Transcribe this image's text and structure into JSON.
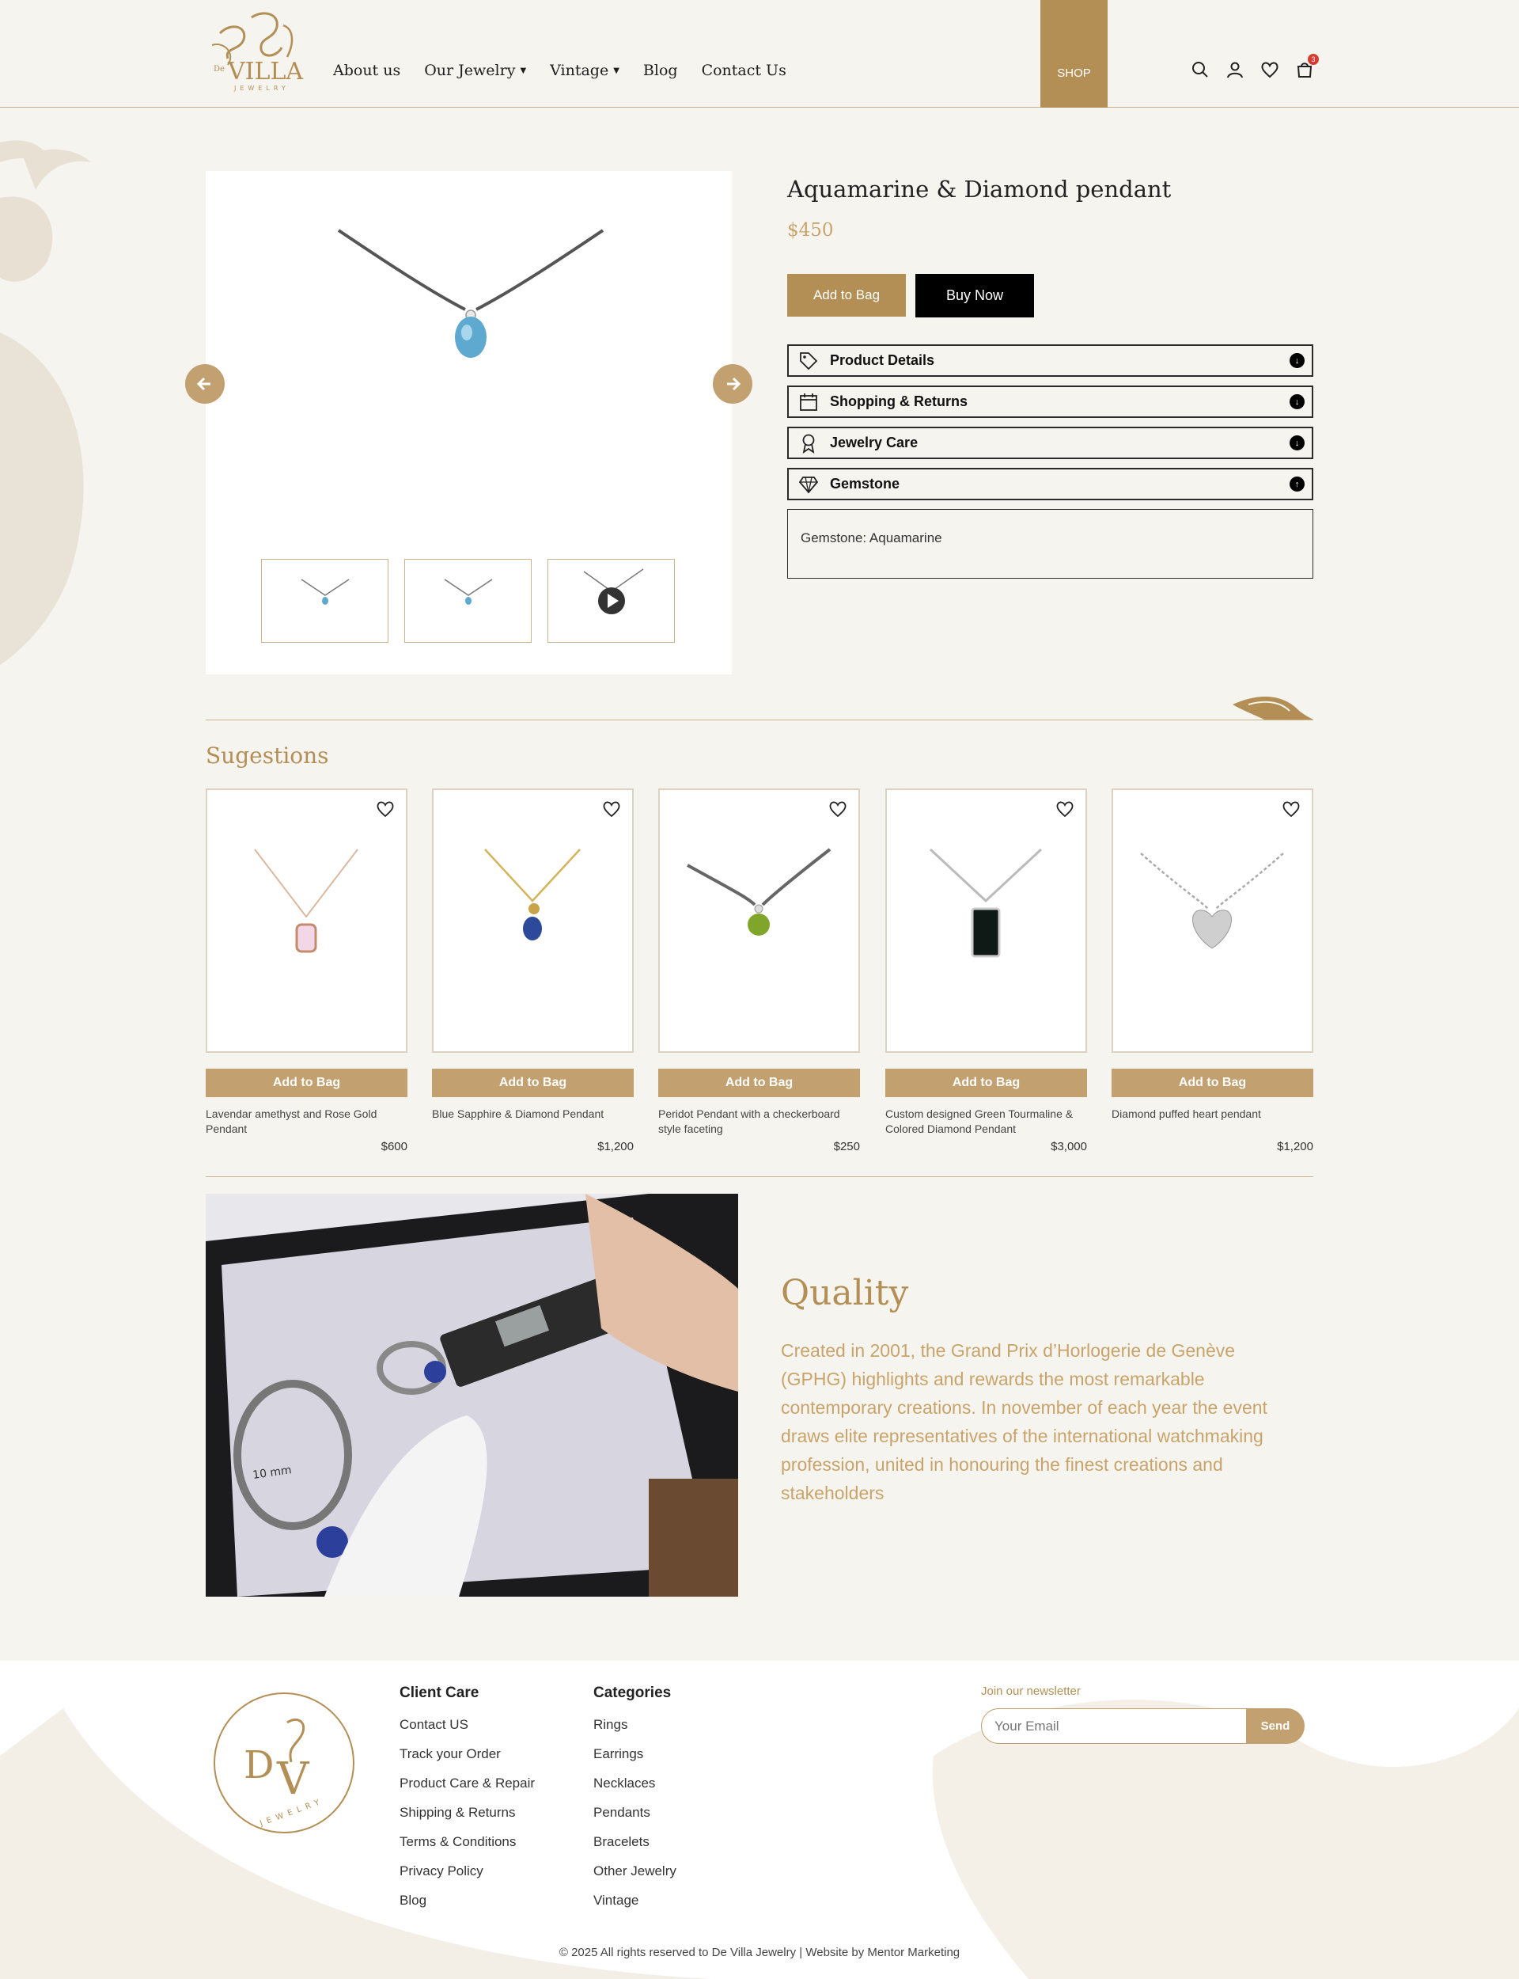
{
  "header": {
    "logo_text": "De VILLA JEWELRY",
    "nav": [
      {
        "label": "About us",
        "has_dropdown": false
      },
      {
        "label": "Our Jewelry",
        "has_dropdown": true
      },
      {
        "label": "Vintage",
        "has_dropdown": true
      },
      {
        "label": "Blog",
        "has_dropdown": false
      },
      {
        "label": "Contact Us",
        "has_dropdown": false
      }
    ],
    "shop_label": "SHOP",
    "cart_count": "3",
    "icons": [
      "search-icon",
      "user-icon",
      "heart-icon",
      "cart-icon"
    ]
  },
  "product": {
    "title": "Aquamarine & Diamond pendant",
    "price": "$450",
    "add_to_bag": "Add to Bag",
    "buy_now": "Buy Now",
    "accordions": [
      {
        "label": "Product Details",
        "icon": "tag-icon",
        "state": "collapsed"
      },
      {
        "label": "Shopping & Returns",
        "icon": "calendar-icon",
        "state": "collapsed"
      },
      {
        "label": "Jewelry Care",
        "icon": "award-icon",
        "state": "collapsed"
      },
      {
        "label": "Gemstone",
        "icon": "diamond-icon",
        "state": "expanded"
      }
    ],
    "gemstone_text": "Gemstone: Aquamarine"
  },
  "suggestions": {
    "title": "Sugestions",
    "add_label": "Add to Bag",
    "items": [
      {
        "name": "Lavendar amethyst and Rose Gold Pendant",
        "price": "$600"
      },
      {
        "name": "Blue Sapphire & Diamond Pendant",
        "price": "$1,200"
      },
      {
        "name": "Peridot Pendant with a checkerboard style faceting",
        "price": "$250"
      },
      {
        "name": "Custom designed Green Tourmaline & Colored Diamond Pendant",
        "price": "$3,000"
      },
      {
        "name": "Diamond puffed heart pendant",
        "price": "$1,200"
      }
    ]
  },
  "quality": {
    "title": "Quality",
    "text": "Created in 2001, the Grand Prix d’Horlogerie de Genève (GPHG) highlights and rewards the most remarkable contemporary creations. In november of each year the event draws elite representatives of the international watchmaking profession, united in honouring the finest creations and stakeholders"
  },
  "footer": {
    "client_care": {
      "title": "Client Care",
      "links": [
        "Contact US",
        "Track your Order",
        "Product Care & Repair",
        "Shipping & Returns",
        "Terms & Conditions",
        "Privacy Policy",
        "Blog"
      ]
    },
    "categories": {
      "title": "Categories",
      "links": [
        "Rings",
        "Earrings",
        "Necklaces",
        "Pendants",
        "Bracelets",
        "Other Jewelry",
        "Vintage"
      ]
    },
    "newsletter": {
      "label": "Join our newsletter",
      "placeholder": "Your Email",
      "send": "Send"
    },
    "copyright": "© 2025 All rights reserved to De Villa Jewelry | Website by Mentor Marketing"
  },
  "colors": {
    "accent": "#b38f56",
    "background": "#f6f4ef",
    "badge": "#d73a2f"
  }
}
